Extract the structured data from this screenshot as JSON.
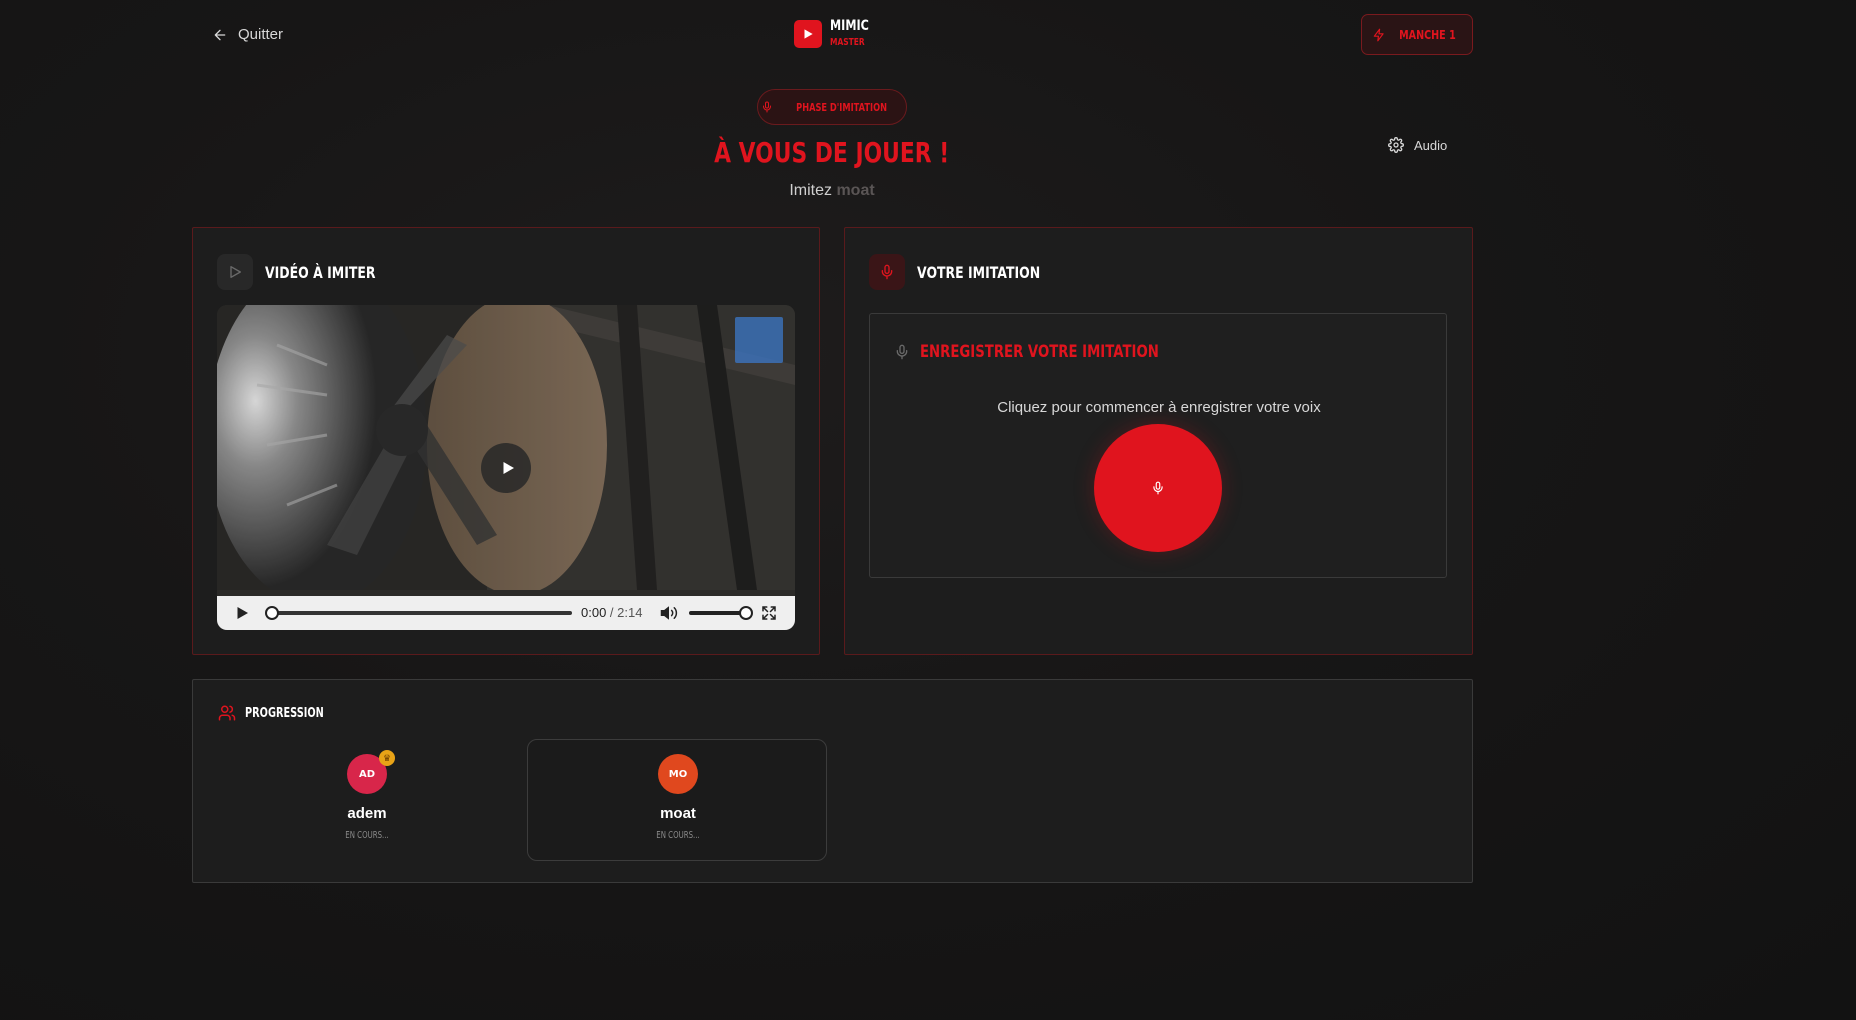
{
  "header": {
    "quit_label": "Quitter",
    "logo_line1": "MIMIC",
    "logo_line2": "MASTER",
    "round_label": "MANCHE 1"
  },
  "phase": {
    "pill_label": "PHASE D'IMITATION",
    "title": "À VOUS DE JOUER !",
    "subtitle_prefix": "Imitez",
    "subtitle_target": "moat",
    "audio_label": "Audio"
  },
  "video_panel": {
    "title": "VIDÉO À IMITER",
    "current_time": "0:00",
    "separator": " / ",
    "duration": "2:14",
    "progress": 0,
    "volume": 1
  },
  "imitation_panel": {
    "title": "VOTRE IMITATION",
    "record_title": "ENREGISTRER VOTRE IMITATION",
    "record_hint": "Cliquez pour commencer à enregistrer votre voix"
  },
  "progression": {
    "title": "PROGRESSION",
    "players": [
      {
        "initials": "AD",
        "name": "adem",
        "status": "EN COURS...",
        "color": "#d8264a",
        "host": true
      },
      {
        "initials": "MO",
        "name": "moat",
        "status": "EN COURS...",
        "color": "#e0481e",
        "host": false
      }
    ]
  },
  "colors": {
    "accent": "#e0141e",
    "background": "#161515",
    "panel": "#1d1d1d"
  }
}
